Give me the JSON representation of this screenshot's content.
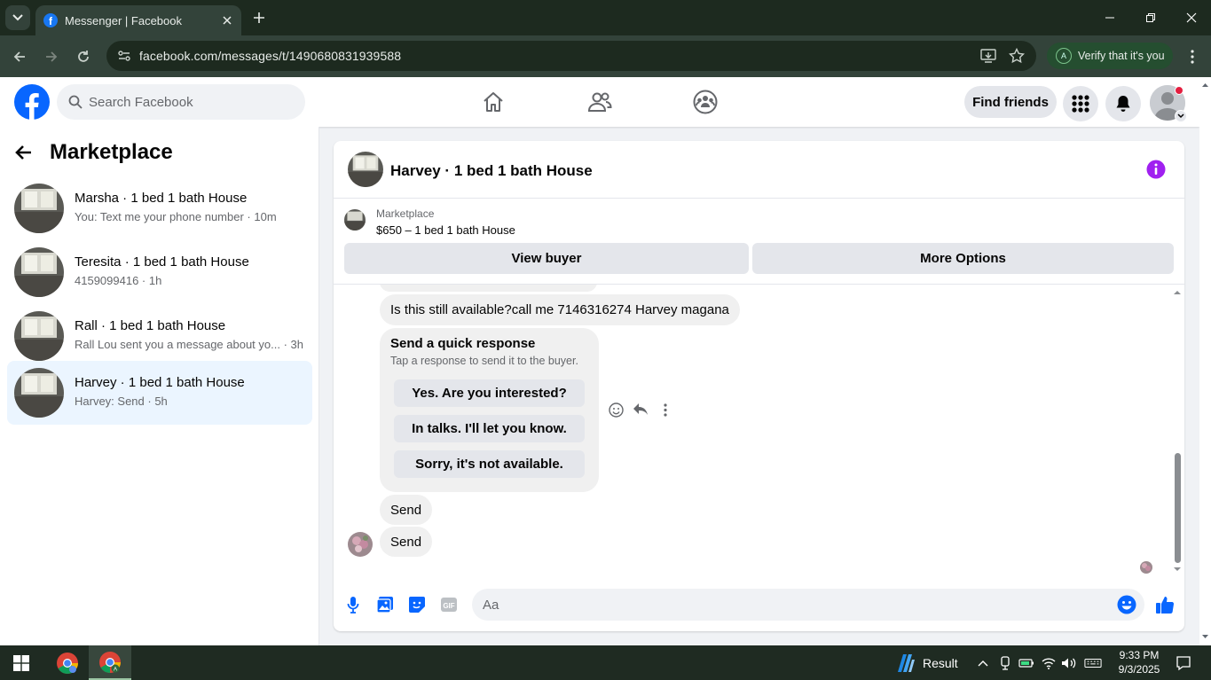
{
  "browser": {
    "tab_title": "Messenger | Facebook",
    "url": "facebook.com/messages/t/1490680831939588",
    "profile_initial": "A",
    "verify_label": "Verify that it's you"
  },
  "fb_header": {
    "search_placeholder": "Search Facebook",
    "find_friends_label": "Find friends",
    "brand_color": "#1877f2",
    "notification_color": "#e41e3f"
  },
  "sidebar": {
    "title": "Marketplace",
    "conversations": [
      {
        "name": "Marsha · 1 bed 1 bath House",
        "preview": "You: Text me your phone number",
        "time": "10m",
        "active": false
      },
      {
        "name": "Teresita · 1 bed 1 bath House",
        "preview": "4159099416",
        "time": "1h",
        "active": false
      },
      {
        "name": "Rall · 1 bed 1 bath House",
        "preview": "Rall Lou sent you a message about yo...",
        "time": "3h",
        "active": false
      },
      {
        "name": "Harvey · 1 bed 1 bath House",
        "preview": "Harvey: Send",
        "time": "5h",
        "active": true
      }
    ]
  },
  "chat": {
    "title": "Harvey · 1 bed 1 bath House",
    "marketplace_label": "Marketplace",
    "listing": "$650 – 1 bed 1 bath House",
    "view_buyer_label": "View buyer",
    "more_options_label": "More Options",
    "messages": {
      "inquiry": "Is this still available?call me 7146316274 Harvey magana",
      "quick_response_title": "Send a quick response",
      "quick_response_subtitle": "Tap a response to send it to the buyer.",
      "quick_responses": [
        "Yes. Are you interested?",
        "In talks. I'll let you know.",
        "Sorry, it's not available."
      ],
      "send_1": "Send",
      "send_2": "Send"
    },
    "composer_placeholder": "Aa",
    "accent_color": "#0866ff",
    "info_color": "#a020f0"
  },
  "taskbar": {
    "result_label": "Result",
    "time": "9:33 PM",
    "date": "9/3/2025"
  }
}
